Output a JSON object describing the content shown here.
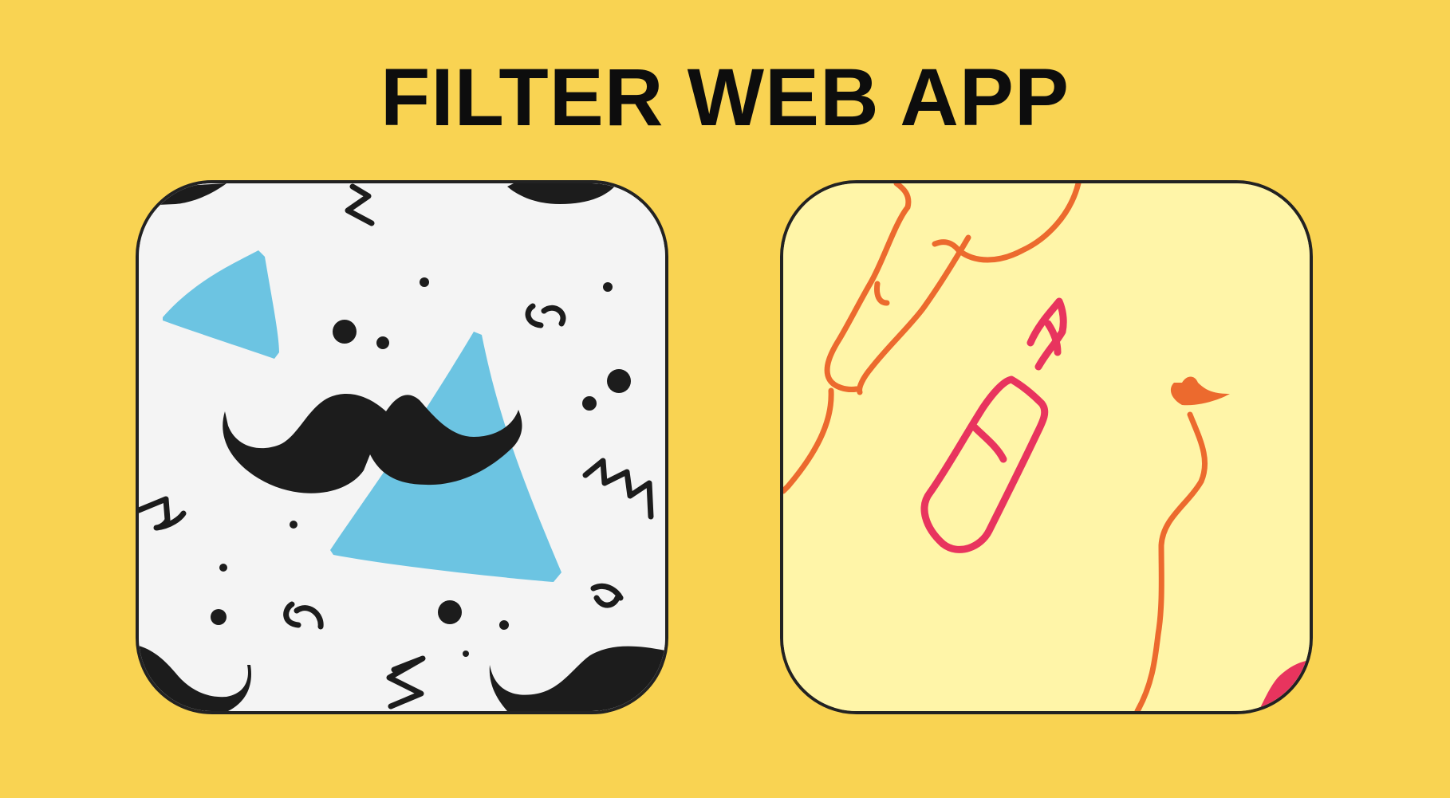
{
  "page": {
    "title": "FILTER WEB APP",
    "background_color": "#F9D352"
  },
  "cards": [
    {
      "id": "mustache",
      "pattern_icon": "mustache-pattern-icon",
      "background_color": "#F4F4F4",
      "accent_color": "#6CC4E2",
      "ink_color": "#1C1C1C",
      "selected": false
    },
    {
      "id": "lipstick",
      "pattern_icon": "lipstick-pattern-icon",
      "background_color": "#FFF5A8",
      "accent_color": "#E8345E",
      "ink_color": "#EC6A2E",
      "selected": false
    }
  ]
}
